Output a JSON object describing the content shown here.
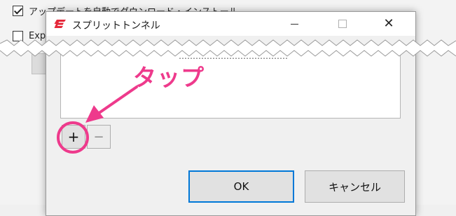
{
  "background": {
    "auto_update_label": "アップデートを自動でダウンロード・インストール",
    "second_option_label": "Exp"
  },
  "dialog": {
    "title": "スプリットトンネル",
    "list_partial_text": "…………………………………",
    "add_button": "+",
    "remove_button": "−",
    "ok_button": "OK",
    "cancel_button": "キャンセル"
  },
  "annotation": {
    "text": "タップ",
    "color": "#ee3a8c"
  },
  "colors": {
    "brand_red": "#e5283a",
    "focus_blue": "#0078d7"
  }
}
